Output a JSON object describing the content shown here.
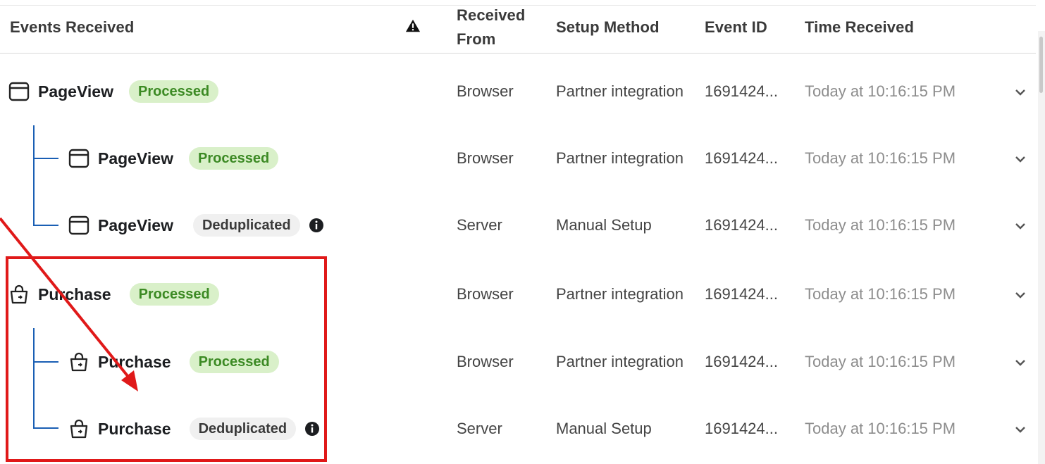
{
  "header": {
    "events_received": "Events Received",
    "received_from_line1": "Received",
    "received_from_line2": "From",
    "setup_method": "Setup Method",
    "event_id": "Event ID",
    "time_received": "Time Received",
    "warning_icon": "warning-triangle-icon"
  },
  "rows": [
    {
      "name": "PageView",
      "status": "Processed",
      "source": "Browser",
      "setup": "Partner integration",
      "event_id": "1691424...",
      "time": "Today at 10:16:15 PM",
      "icon": "browser-window-icon"
    },
    {
      "name": "PageView",
      "status": "Processed",
      "source": "Browser",
      "setup": "Partner integration",
      "event_id": "1691424...",
      "time": "Today at 10:16:15 PM",
      "icon": "browser-window-icon"
    },
    {
      "name": "PageView",
      "status": "Deduplicated",
      "source": "Server",
      "setup": "Manual Setup",
      "event_id": "1691424...",
      "time": "Today at 10:16:15 PM",
      "icon": "browser-window-icon"
    },
    {
      "name": "Purchase",
      "status": "Processed",
      "source": "Browser",
      "setup": "Partner integration",
      "event_id": "1691424...",
      "time": "Today at 10:16:15 PM",
      "icon": "shopping-bag-icon"
    },
    {
      "name": "Purchase",
      "status": "Processed",
      "source": "Browser",
      "setup": "Partner integration",
      "event_id": "1691424...",
      "time": "Today at 10:16:15 PM",
      "icon": "shopping-bag-icon"
    },
    {
      "name": "Purchase",
      "status": "Deduplicated",
      "source": "Server",
      "setup": "Manual Setup",
      "event_id": "1691424...",
      "time": "Today at 10:16:15 PM",
      "icon": "shopping-bag-icon"
    }
  ],
  "colors": {
    "processed_bg": "#d9f0c9",
    "processed_text": "#3c8a24",
    "dedup_bg": "#f0f0f0",
    "tree_line": "#1a5fb4",
    "annotation_red": "#e01919"
  }
}
